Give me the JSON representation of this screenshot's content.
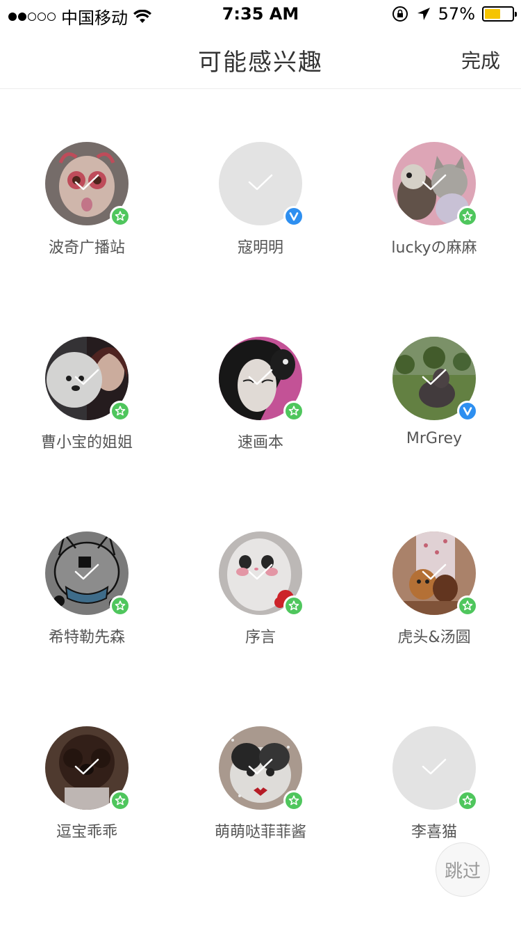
{
  "status_bar": {
    "carrier": "中国移动",
    "time": "7:35 AM",
    "battery_percent": "57%",
    "battery_level": 0.57,
    "signal_bars_filled": 2,
    "signal_bars_total": 5,
    "icons": [
      "wifi-icon",
      "orientation-lock-icon",
      "location-arrow-icon",
      "battery-icon"
    ],
    "battery_color": "#f5c400"
  },
  "nav": {
    "title": "可能感兴趣",
    "done_label": "完成"
  },
  "users": [
    {
      "name": "波奇广播站",
      "badge": "star",
      "avatar": "cartoon-pink"
    },
    {
      "name": "寇明明",
      "badge": "verified",
      "avatar": "placeholder"
    },
    {
      "name": "luckyの麻麻",
      "badge": "star",
      "avatar": "plush-cat"
    },
    {
      "name": "曹小宝的姐姐",
      "badge": "star",
      "avatar": "girl-dog"
    },
    {
      "name": "速画本",
      "badge": "star",
      "avatar": "woman-pink"
    },
    {
      "name": "MrGrey",
      "badge": "verified",
      "avatar": "grey-dog-grass"
    },
    {
      "name": "希特勒先森",
      "badge": "star",
      "avatar": "sketch-cat"
    },
    {
      "name": "序言",
      "badge": "star",
      "avatar": "white-cat"
    },
    {
      "name": "虎头&汤圆",
      "badge": "star",
      "avatar": "two-cats"
    },
    {
      "name": "逗宝乖乖",
      "badge": "star",
      "avatar": "brown-dog"
    },
    {
      "name": "萌萌哒菲菲酱",
      "badge": "star",
      "avatar": "exotic-cat"
    },
    {
      "name": "李喜猫",
      "badge": "star",
      "avatar": "placeholder"
    }
  ],
  "skip_label": "跳过",
  "colors": {
    "star_badge": "#4fc65d",
    "verified_badge": "#2e8ff0",
    "placeholder_avatar": "#e3e3e3"
  }
}
